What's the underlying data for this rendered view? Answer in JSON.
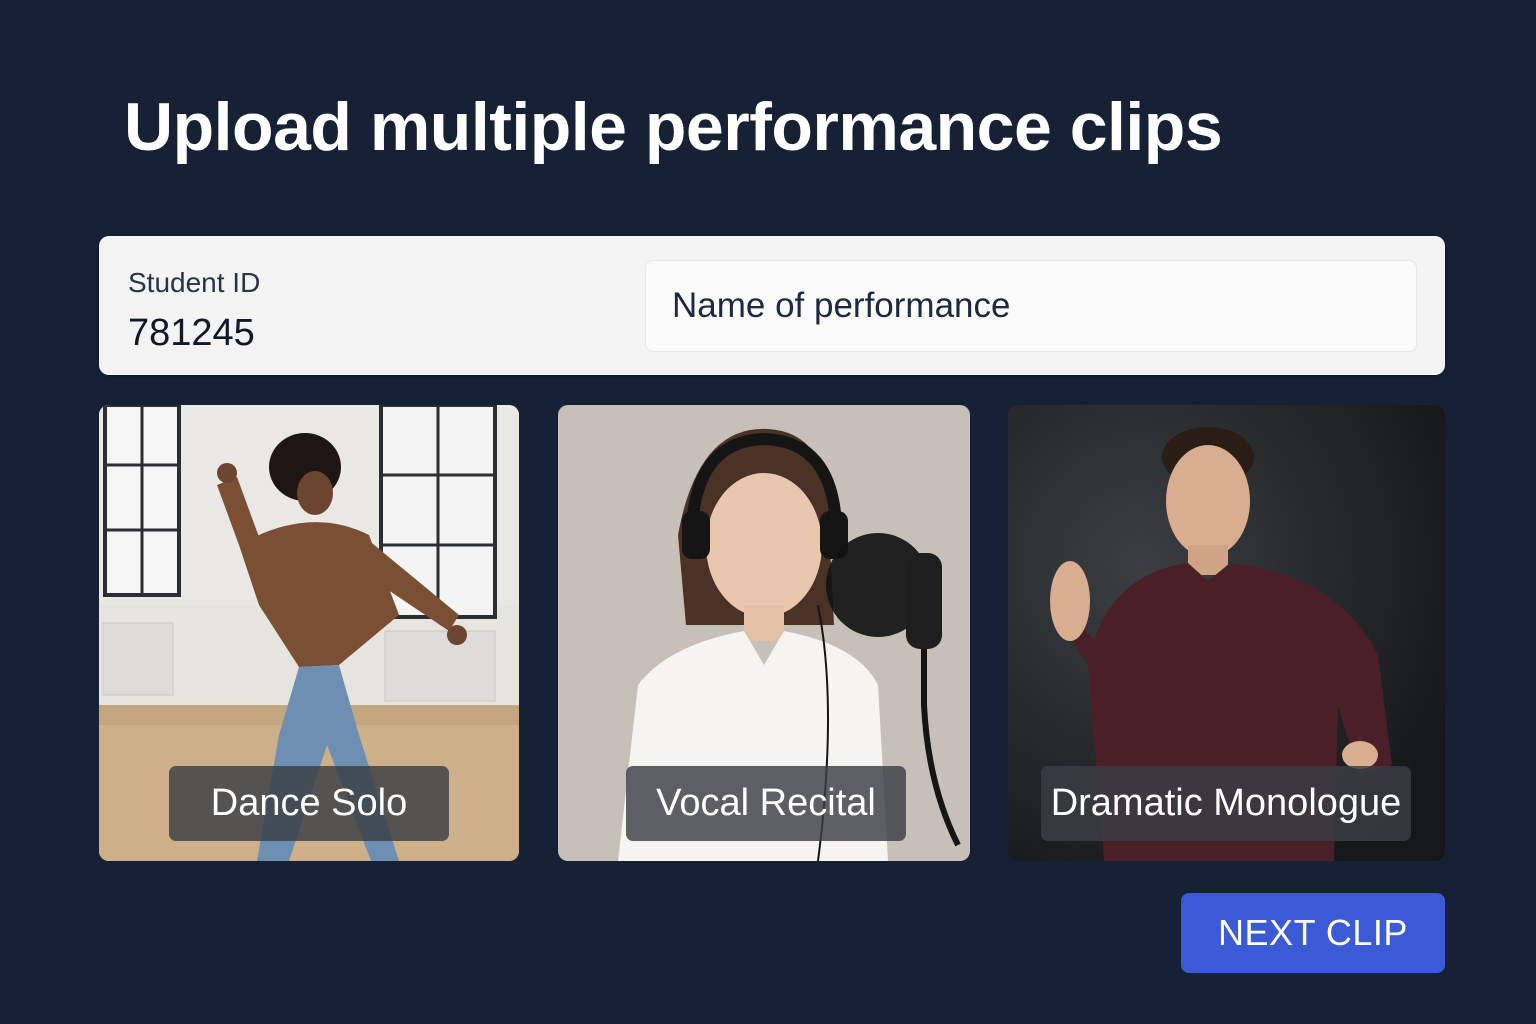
{
  "page": {
    "title": "Upload multiple performance clips"
  },
  "student": {
    "label": "Student ID",
    "value": "781245"
  },
  "performance_input": {
    "placeholder": "Name of performance",
    "value": ""
  },
  "clips": [
    {
      "label": "Dance Solo",
      "image": "dancer-photo"
    },
    {
      "label": "Vocal Recital",
      "image": "singer-photo"
    },
    {
      "label": "Dramatic Monologue",
      "image": "actor-photo"
    }
  ],
  "actions": {
    "next_label": "NEXT CLIP"
  },
  "colors": {
    "background": "#172136",
    "accent": "#3b5bd6",
    "card": "#f3f3f4"
  }
}
